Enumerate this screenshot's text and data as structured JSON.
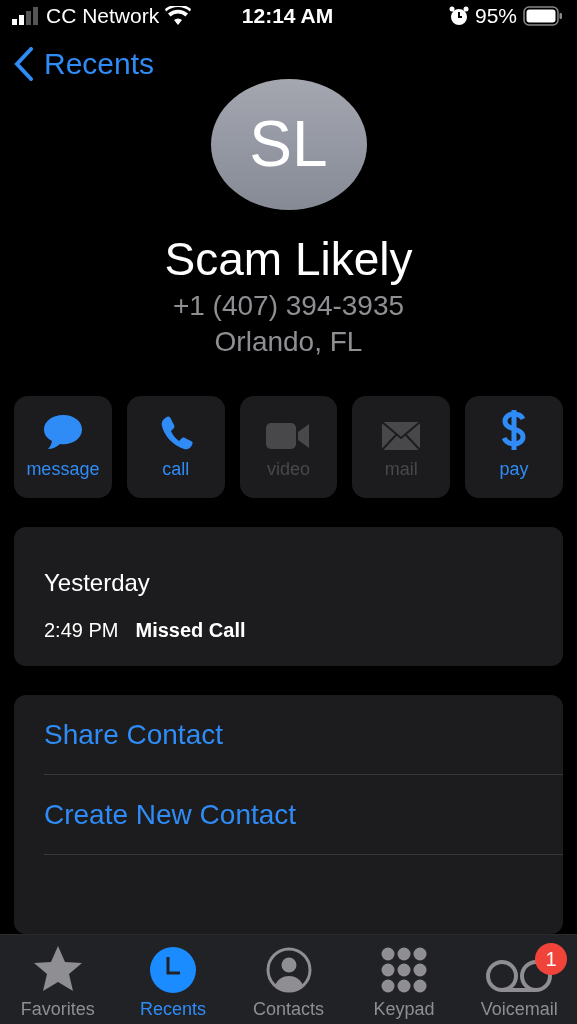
{
  "status_bar": {
    "carrier": "CC Network",
    "time": "12:14 AM",
    "battery": "95%"
  },
  "nav": {
    "back": "Recents"
  },
  "contact": {
    "initials": "SL",
    "name": "Scam Likely",
    "phone": "+1 (407) 394-3935",
    "location": "Orlando, FL"
  },
  "actions": [
    {
      "kind": "message",
      "label": "message",
      "disabled": false
    },
    {
      "kind": "call",
      "label": "call",
      "disabled": false
    },
    {
      "kind": "video",
      "label": "video",
      "disabled": true
    },
    {
      "kind": "mail",
      "label": "mail",
      "disabled": true
    },
    {
      "kind": "pay",
      "label": "pay",
      "disabled": false
    }
  ],
  "history": {
    "date": "Yesterday",
    "entries": [
      {
        "time": "2:49 PM",
        "type": "Missed Call"
      }
    ]
  },
  "options": [
    "Share Contact",
    "Create New Contact"
  ],
  "tabs": [
    {
      "kind": "favorites",
      "label": "Favorites",
      "selected": false
    },
    {
      "kind": "recents",
      "label": "Recents",
      "selected": true
    },
    {
      "kind": "contacts",
      "label": "Contacts",
      "selected": false
    },
    {
      "kind": "keypad",
      "label": "Keypad",
      "selected": false
    },
    {
      "kind": "voicemail",
      "label": "Voicemail",
      "selected": false,
      "badge": "1"
    }
  ]
}
